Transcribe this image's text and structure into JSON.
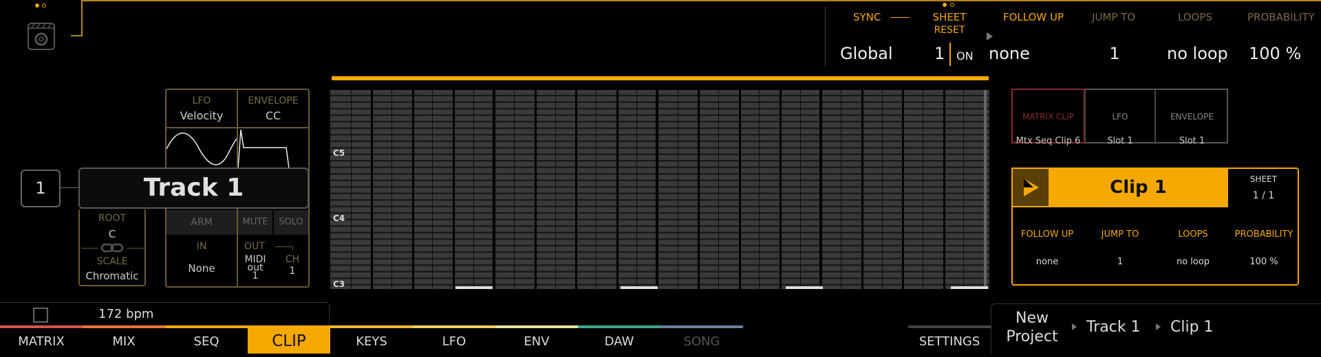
{
  "header": {
    "sync_label": "SYNC",
    "sheet_label": "SHEET",
    "reset_label": "RESET",
    "sync_value": "Global",
    "sheet_value": "1",
    "on_label": "ON",
    "columns": [
      {
        "label": "FOLLOW UP",
        "value": "none"
      },
      {
        "label": "JUMP TO",
        "value": "1"
      },
      {
        "label": "LOOPS",
        "value": "no loop"
      },
      {
        "label": "PROBABILITY",
        "value": "100 %"
      }
    ]
  },
  "track": {
    "number": "1",
    "name": "Track 1",
    "lfo_label": "LFO",
    "lfo_value": "Velocity",
    "envelope_label": "ENVELOPE",
    "envelope_value": "CC",
    "root_label": "ROOT",
    "root_value": "C",
    "scale_label": "SCALE",
    "scale_value": "Chromatic",
    "arm_label": "ARM",
    "mute_label": "MUTE",
    "solo_label": "SOLO",
    "in_label": "IN",
    "in_value": "None",
    "out_label": "OUT",
    "out_value_1": "MIDI",
    "out_value_2": "out",
    "out_value_3": "1",
    "ch_label": "CH",
    "ch_value": "1"
  },
  "roll": {
    "labels": [
      "C5",
      "C4",
      "C3"
    ]
  },
  "clip_panel": {
    "matrix_clip_label": "MATRIX CLIP",
    "matrix_clip_value": "Mtx Seq Clip 6",
    "lfo_label": "LFO",
    "lfo_value": "Slot 1",
    "envelope_label": "ENVELOPE",
    "envelope_value": "Slot 1",
    "clip_name": "Clip 1",
    "sheet_label": "SHEET",
    "sheet_value": "1 / 1",
    "columns": [
      {
        "label": "FOLLOW UP",
        "value": "none"
      },
      {
        "label": "JUMP TO",
        "value": "1"
      },
      {
        "label": "LOOPS",
        "value": "no loop"
      },
      {
        "label": "PROBABILITY",
        "value": "100 %"
      }
    ]
  },
  "status": {
    "bpm": "172 bpm"
  },
  "nav": {
    "items": [
      "MATRIX",
      "MIX",
      "SEQ",
      "CLIP",
      "KEYS",
      "LFO",
      "ENV",
      "DAW",
      "SONG"
    ],
    "settings": "SETTINGS"
  },
  "breadcrumb": {
    "project_line1": "New",
    "project_line2": "Project",
    "track": "Track 1",
    "clip": "Clip 1"
  },
  "colors": {
    "accent": "#f5a800",
    "nav_matrix": "#d9534f",
    "nav_mix": "#e8743b",
    "nav_seq": "#f5a800",
    "nav_clip": "#f5a800",
    "nav_keys": "#f5b82e",
    "nav_lfo": "#f0d060",
    "nav_env": "#e8e4a0",
    "nav_daw": "#3aa88a",
    "nav_song": "#6a7fa0"
  }
}
